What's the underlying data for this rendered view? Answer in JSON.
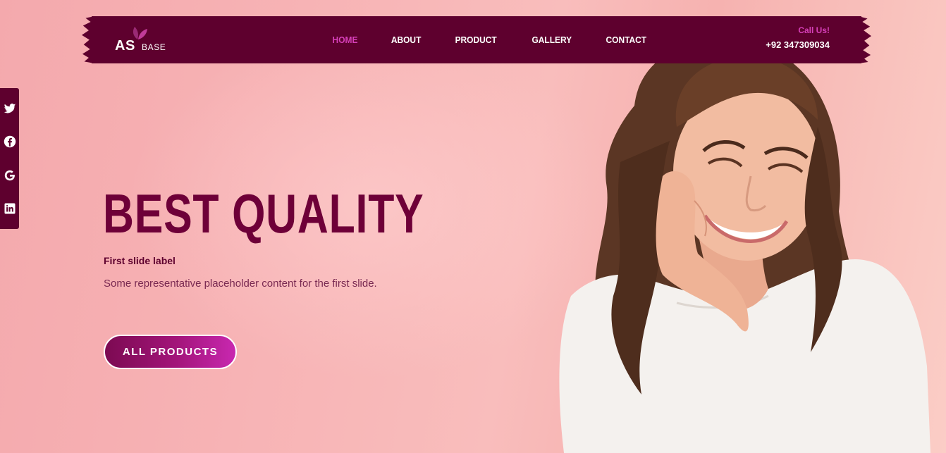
{
  "brand": {
    "logo_as": "AS",
    "logo_base": "BASE"
  },
  "nav": {
    "items": [
      {
        "label": "HOME",
        "active": true
      },
      {
        "label": "ABOUT"
      },
      {
        "label": "PRODUCT"
      },
      {
        "label": "GALLERY"
      },
      {
        "label": "CONTACT"
      }
    ]
  },
  "contact": {
    "label": "Call Us!",
    "phone": "+92 347309034"
  },
  "social": {
    "icons": [
      "twitter-icon",
      "facebook-icon",
      "google-icon",
      "linkedin-icon"
    ]
  },
  "hero": {
    "title": "BEST QUALITY",
    "slide_label": "First slide label",
    "slide_text": "Some representative placeholder content for the first slide.",
    "cta_label": "ALL PRODUCTS"
  },
  "colors": {
    "primary": "#5e002e",
    "accent": "#d63fb9",
    "title": "#6e0038",
    "background": "#f7b3b5"
  }
}
